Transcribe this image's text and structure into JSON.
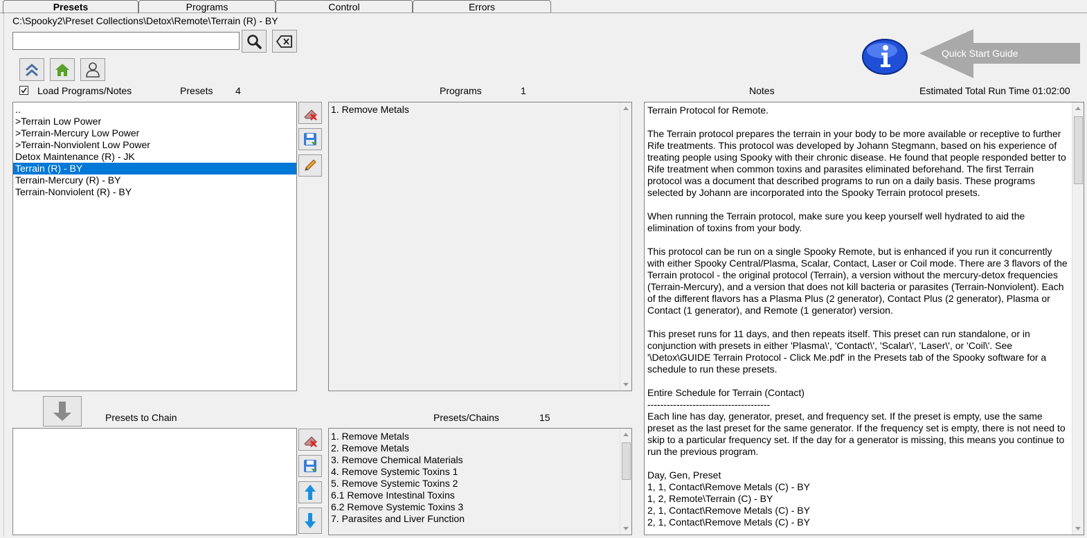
{
  "tabs": [
    {
      "label": "Presets",
      "active": true
    },
    {
      "label": "Programs",
      "active": false
    },
    {
      "label": "Control",
      "active": false
    },
    {
      "label": "Errors",
      "active": false
    }
  ],
  "path": "C:\\Spooky2\\Preset Collections\\Detox\\Remote\\Terrain (R) - BY",
  "search": {
    "value": "",
    "placeholder": ""
  },
  "quick_start_label": "Quick Start Guide",
  "load_programs_label": "Load Programs/Notes",
  "load_programs_checked": true,
  "presets_label": "Presets",
  "presets_count": "4",
  "programs_label": "Programs",
  "programs_count": "1",
  "notes_label": "Notes",
  "runtime_label": "Estimated Total Run Time 01:02:00",
  "preset_list": [
    {
      "label": "..",
      "selected": false
    },
    {
      "label": ">Terrain Low Power",
      "selected": false
    },
    {
      "label": ">Terrain-Mercury Low Power",
      "selected": false
    },
    {
      "label": ">Terrain-Nonviolent Low Power",
      "selected": false
    },
    {
      "label": "Detox Maintenance (R) - JK",
      "selected": false
    },
    {
      "label": "Terrain (R) - BY",
      "selected": true
    },
    {
      "label": "Terrain-Mercury (R) - BY",
      "selected": false
    },
    {
      "label": "Terrain-Nonviolent (R) - BY",
      "selected": false
    }
  ],
  "program_list": [
    "1. Remove Metals"
  ],
  "notes_text": "Terrain Protocol for Remote.\n\nThe Terrain protocol prepares the terrain in your body to be more available or receptive to further Rife treatments. This protocol was developed by Johann Stegmann, based on his experience of treating people using Spooky with their chronic disease. He found that people responded better to Rife treatment when common toxins and parasites eliminated beforehand. The first Terrain protocol was a document that described programs to run on a daily basis. These programs selected by Johann are incorporated into the Spooky Terrain protocol presets.\n\nWhen running the Terrain protocol, make sure you keep yourself well hydrated to aid the elimination of toxins from your body.\n\nThis protocol can be run on a single Spooky Remote, but is enhanced if you run it concurrently with either Spooky Central/Plasma, Scalar, Contact, Laser or Coil mode. There are 3 flavors of the Terrain protocol - the original protocol (Terrain), a version without the mercury-detox frequencies (Terrain-Mercury), and a version that does not kill bacteria or parasites (Terrain-Nonviolent). Each of the different flavors has a Plasma Plus (2 generator), Contact Plus (2 generator), Plasma or Contact (1 generator), and Remote (1 generator) version.\n\nThis preset runs for 11 days, and then repeats itself. This preset can run standalone, or in conjunction with presets in either 'Plasma\\', 'Contact\\', 'Scalar\\', 'Laser\\', or 'Coil\\'. See '\\Detox\\GUIDE Terrain Protocol - Click Me.pdf' in the Presets tab of the Spooky software for a schedule to run these presets.\n\nEntire Schedule for Terrain (Contact)\n--------------------------------------\nEach line has day, generator, preset, and frequency set. If the preset is empty, use the same preset as the last preset for the same generator. If the frequency set is empty, there is not need to skip to a particular frequency set. If the day for a generator is missing, this means you continue to run the previous program.\n\nDay, Gen, Preset\n1, 1, Contact\\Remove Metals (C) - BY\n1, 2, Remote\\Terrain (C) - BY\n2, 1, Contact\\Remove Metals (C) - BY\n2, 1, Contact\\Remove Metals (C) - BY",
  "presets_to_chain_label": "Presets to Chain",
  "presets_chains_label": "Presets/Chains",
  "presets_chains_count": "15",
  "chain_list": [
    "1. Remove Metals",
    "2. Remove Metals",
    "3. Remove Chemical Materials",
    "4. Remove Systemic Toxins 1",
    "5. Remove Systemic Toxins 2",
    "6.1 Remove Intestinal Toxins",
    "6.2 Remove Systemic Toxins 3",
    "7. Parasites and Liver Function"
  ],
  "icons": {
    "search": "search-icon",
    "clear": "backspace-icon",
    "up": "double-chevron-up-icon",
    "home": "home-icon",
    "user": "user-icon",
    "info": "info-icon",
    "erase": "eraser-icon",
    "save": "save-icon",
    "edit": "pencil-icon",
    "down_arrow": "arrow-down-icon",
    "move_up": "arrow-up-icon",
    "move_down": "arrow-down-icon"
  },
  "colors": {
    "selection": "#0078d7",
    "info_blue": "#1f4fd6",
    "accent_green": "#5aa02c"
  }
}
